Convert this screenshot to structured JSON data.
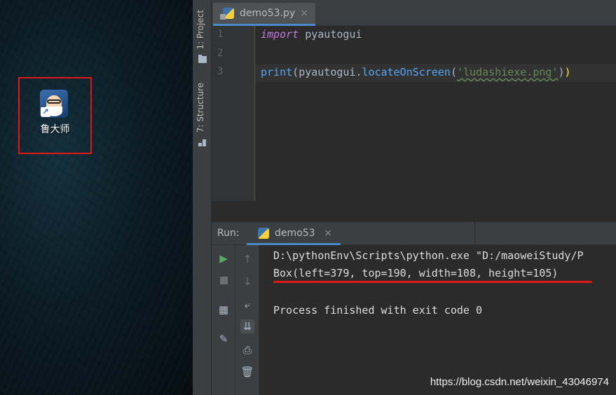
{
  "desktop": {
    "shortcut_label": "鲁大师"
  },
  "ide": {
    "side_tabs": {
      "project": "1: Project",
      "structure": "7: Structure"
    },
    "editor_tab": {
      "filename": "demo53.py",
      "close": "×"
    },
    "line_numbers": [
      "1",
      "2",
      "3"
    ],
    "code": {
      "line1_keyword": "import",
      "line1_rest": " pyautogui",
      "line3_print": "print",
      "line3_open": "(",
      "line3_module": "pyautogui.",
      "line3_func": "locateOnScreen",
      "line3_paren": "(",
      "line3_string": "'ludashiexe.png'",
      "line3_close1": ")",
      "line3_close2": ")"
    },
    "run_panel": {
      "label": "Run:",
      "tab_name": "demo53",
      "close": "×",
      "output": [
        "D:\\pythonEnv\\Scripts\\python.exe \"D:/maoweiStudy/P",
        "Box(left=379, top=190, width=108, height=105)",
        "",
        "Process finished with exit code 0"
      ]
    }
  },
  "watermark": "https://blog.csdn.net/weixin_43046974"
}
